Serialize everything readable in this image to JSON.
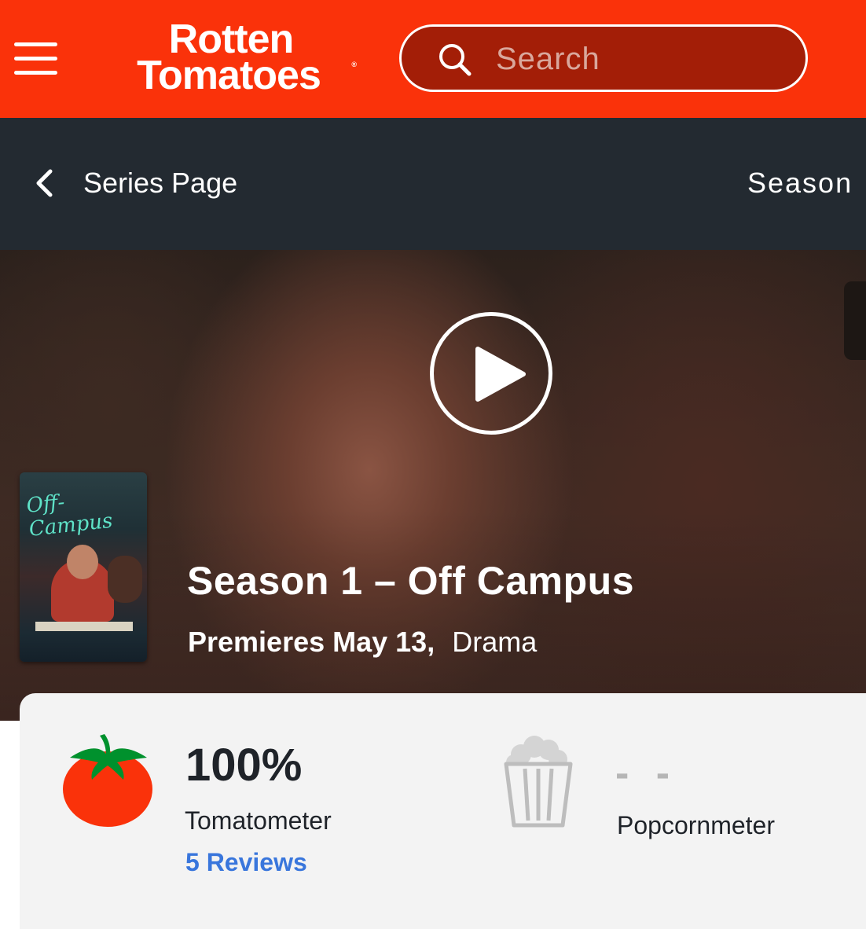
{
  "header": {
    "logo_line1": "Rotten",
    "logo_line2": "Tomatoes",
    "search_placeholder": "Search",
    "brand_color": "#fa320a"
  },
  "subnav": {
    "back_label": "Series Page",
    "right_tab": "Season"
  },
  "hero": {
    "title": "Season 1 – Off Campus",
    "premiere": "Premieres May 13,",
    "genre": "Drama",
    "poster_title": "Off-Campus"
  },
  "scores": {
    "tomatometer": {
      "value": "100%",
      "label": "Tomatometer",
      "reviews": "5 Reviews"
    },
    "popcornmeter": {
      "value": "- -",
      "label": "Popcornmeter"
    }
  },
  "icons": {
    "menu": "hamburger-icon",
    "search": "search-icon",
    "back": "chevron-left-icon",
    "play": "play-icon",
    "tomato": "tomato-icon",
    "popcorn": "popcorn-icon"
  }
}
